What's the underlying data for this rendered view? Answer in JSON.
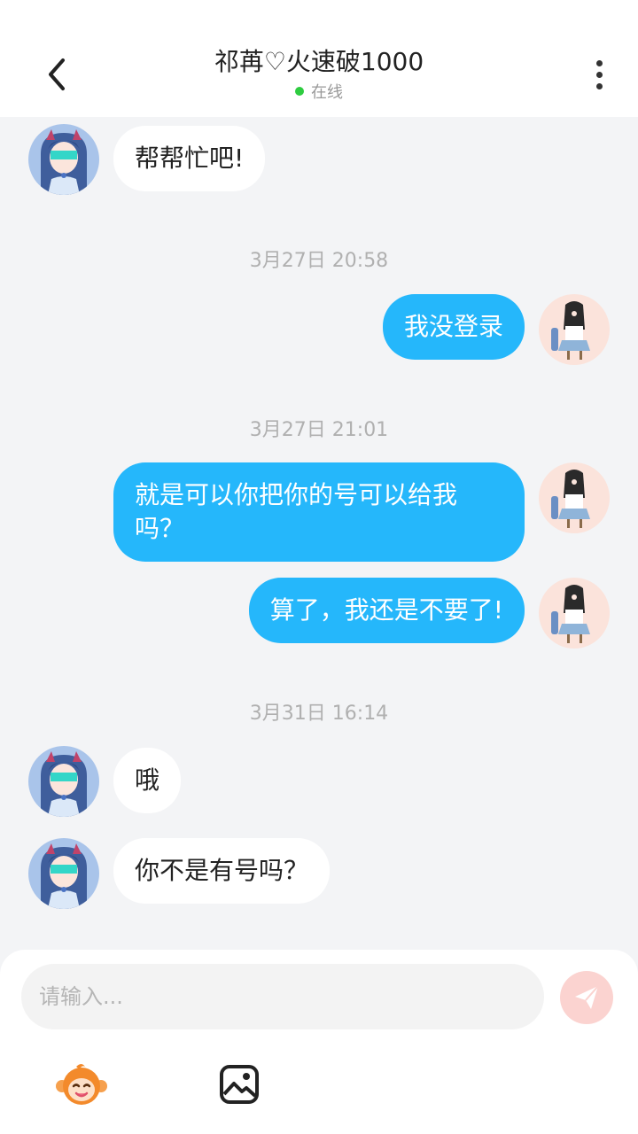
{
  "header": {
    "title": "祁苒♡火速破1000",
    "status": "在线",
    "status_color": "#2ecc40",
    "back_icon": "chevron-left-icon",
    "more_icon": "more-vertical-icon"
  },
  "messages": [
    {
      "side": "left",
      "text": "帮帮忙吧!"
    },
    {
      "timestamp": "3月27日 20:58"
    },
    {
      "side": "right",
      "text": "我没登录"
    },
    {
      "timestamp": "3月27日 21:01"
    },
    {
      "side": "right",
      "text": "就是可以你把你的号可以给我吗？"
    },
    {
      "side": "right",
      "text": "算了，我还是不要了!"
    },
    {
      "timestamp": "3月31日 16:14"
    },
    {
      "side": "left",
      "text": "哦"
    },
    {
      "side": "left",
      "text": "你不是有号吗？"
    }
  ],
  "input": {
    "placeholder": "请输入...",
    "send_icon": "send-icon",
    "send_color": "#fbd3d0"
  },
  "toolbar": {
    "emoji_icon": "monkey-emoji-icon",
    "image_icon": "image-icon"
  },
  "colors": {
    "accent": "#25b7fb",
    "background": "#f3f4f6"
  }
}
